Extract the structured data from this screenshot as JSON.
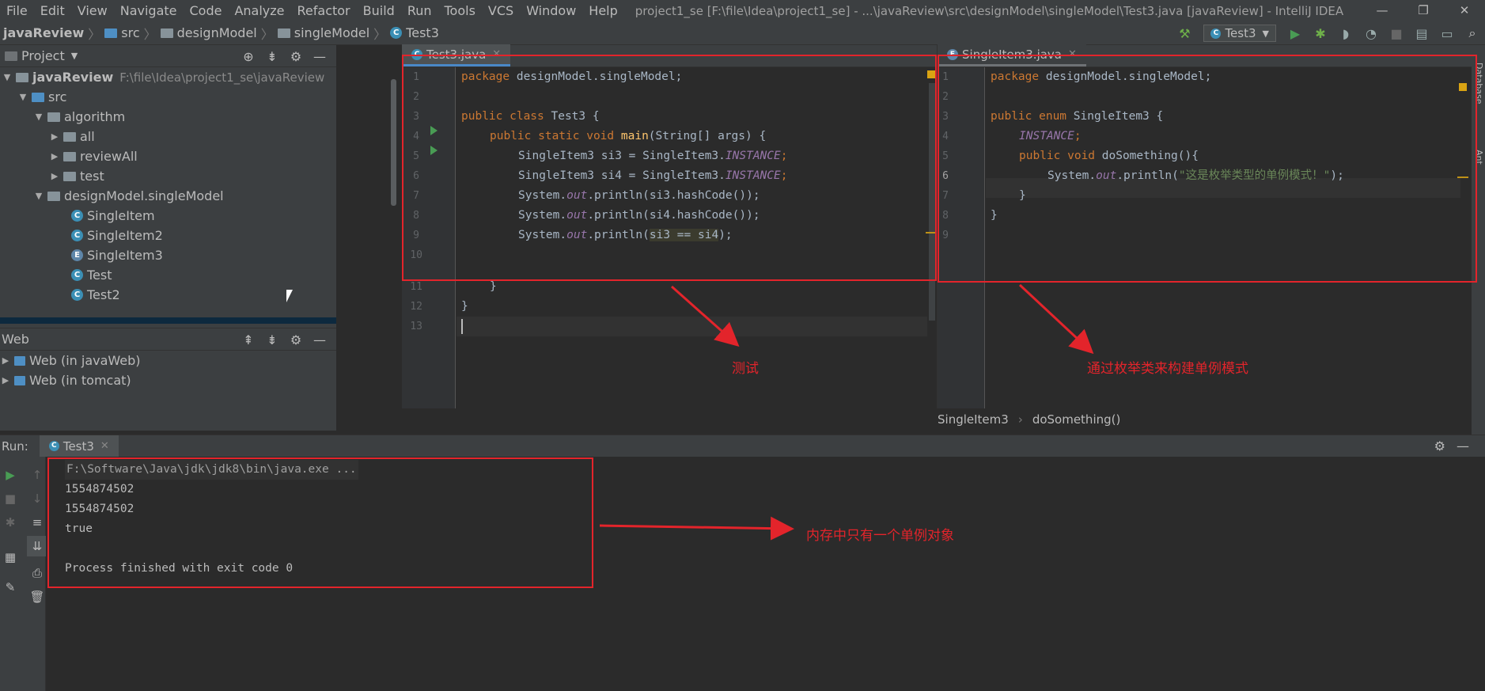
{
  "menu": [
    "File",
    "Edit",
    "View",
    "Navigate",
    "Code",
    "Analyze",
    "Refactor",
    "Build",
    "Run",
    "Tools",
    "VCS",
    "Window",
    "Help"
  ],
  "window_title": "project1_se [F:\\file\\Idea\\project1_se] - ...\\javaReview\\src\\designModel\\singleModel\\Test3.java [javaReview] - IntelliJ IDEA",
  "breadcrumbs": [
    "javaReview",
    "src",
    "designModel",
    "singleModel",
    "Test3"
  ],
  "run_config": "Test3",
  "project_panel": {
    "title": "Project",
    "tree": [
      {
        "label": "javaReview",
        "path": "F:\\file\\Idea\\project1_se\\javaReview"
      },
      {
        "label": "src"
      },
      {
        "label": "algorithm"
      },
      {
        "label": "all"
      },
      {
        "label": "reviewAll"
      },
      {
        "label": "test"
      },
      {
        "label": "designModel.singleModel"
      },
      {
        "label": "SingleItem"
      },
      {
        "label": "SingleItem2"
      },
      {
        "label": "SingleItem3"
      },
      {
        "label": "Test"
      },
      {
        "label": "Test2"
      }
    ]
  },
  "web_panel": {
    "title": "Web",
    "items": [
      "Web (in javaWeb)",
      "Web (in tomcat)"
    ]
  },
  "editor_left": {
    "tab": "Test3.java",
    "lines": {
      "l1a": "package",
      "l1b": " designModel.singleModel;",
      "l3a": "public class",
      "l3b": " Test3 {",
      "l4a": "public static void",
      "l4b": "main",
      "l4c": "(String[] args) {",
      "l5a": "SingleItem3 si3 = SingleItem3.",
      "l5b": "INSTANCE",
      "l5c": ";",
      "l6a": "SingleItem3 si4 = SingleItem3.",
      "l6b": "INSTANCE",
      "l6c": ";",
      "l7a": "System.",
      "l7b": "out",
      "l7c": ".println(si3.hashCode());",
      "l8a": "System.",
      "l8b": "out",
      "l8c": ".println(si4.hashCode());",
      "l9a": "System.",
      "l9b": "out",
      "l9c": ".println(",
      "l9d": "si3 == si4",
      "l9e": ");",
      "l11": "}",
      "l12": "}"
    }
  },
  "editor_right": {
    "tab": "SingleItem3.java",
    "lines": {
      "l1a": "package",
      "l1b": " designModel.singleModel;",
      "l3a": "public enum",
      "l3b": " SingleItem3 {",
      "l4": "INSTANCE",
      "l4c": ";",
      "l5a": "public void",
      "l5b": " doSomething(){",
      "l6a": "System.",
      "l6b": "out",
      "l6c": ".println(",
      "l6d": "\"这是枚举类型的单例模式！\"",
      "l6e": ");",
      "l7": "}",
      "l8": "}"
    },
    "breadcrumb": [
      "SingleItem3",
      "doSomething()"
    ]
  },
  "run_panel": {
    "label": "Run:",
    "tab": "Test3",
    "console": [
      "F:\\Software\\Java\\jdk\\jdk8\\bin\\java.exe ...",
      "1554874502",
      "1554874502",
      "true",
      "",
      "Process finished with exit code 0"
    ]
  },
  "annotations": {
    "test": "测试",
    "enum_singleton": "通过枚举类来构建单例模式",
    "one_instance": "内存中只有一个单例对象",
    "color": "#e3242b"
  },
  "right_strip": [
    "Database",
    "Ant"
  ]
}
